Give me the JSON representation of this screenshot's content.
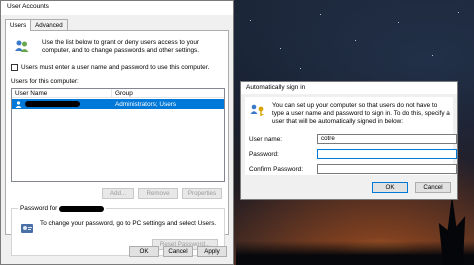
{
  "user_accounts": {
    "title": "User Accounts",
    "tabs": [
      "Users",
      "Advanced"
    ],
    "intro_text": "Use the list below to grant or deny users access to your computer, and to change passwords and other settings.",
    "must_enter_label": "Users must enter a user name and password to use this computer.",
    "must_enter_checked": false,
    "users_label": "Users for this computer:",
    "columns": [
      "User Name",
      "Group"
    ],
    "rows": [
      {
        "group": "Administrators; Users"
      }
    ],
    "buttons": {
      "add": "Add...",
      "remove": "Remove",
      "properties": "Properties"
    },
    "password_label": "Password for",
    "password_text": "To change your password, go to PC settings and select Users.",
    "reset_label": "Reset Password...",
    "ok": "OK",
    "cancel": "Cancel",
    "apply": "Apply"
  },
  "auto_sign_in": {
    "title": "Automatically sign in",
    "text": "You can set up your computer so that users do not have to type a user name and password to sign in. To do this, specify a user that will be automatically signed in below:",
    "fields": {
      "username_label": "User name:",
      "username_value": "cotre",
      "password_label": "Password:",
      "confirm_label": "Confirm Password:"
    },
    "ok": "OK",
    "cancel": "Cancel"
  },
  "colors": {
    "accent": "#0078d7",
    "window": "#f0f0f0"
  }
}
